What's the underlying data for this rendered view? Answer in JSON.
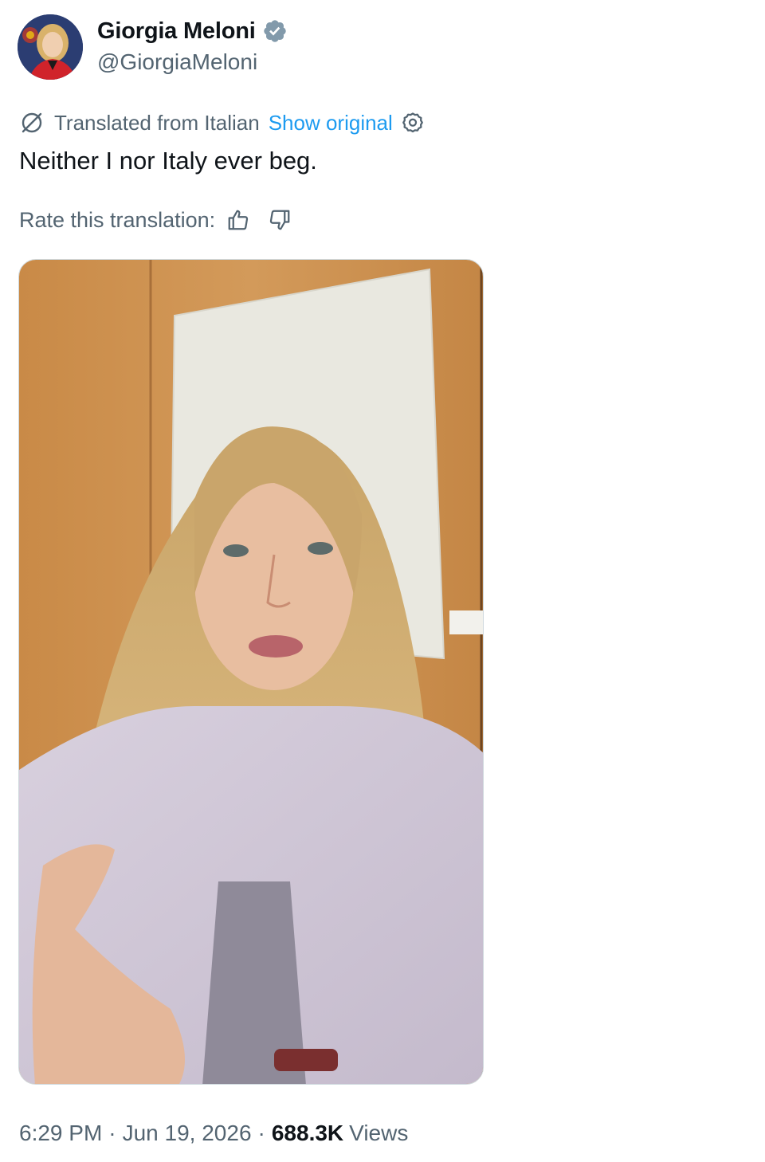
{
  "author": {
    "display_name": "Giorgia Meloni",
    "handle": "@GiorgiaMeloni",
    "verified": true,
    "avatar_icon": "profile-photo"
  },
  "translation": {
    "label": "Translated from Italian",
    "show_original_label": "Show original",
    "text": "Neither I nor Italy ever beg.",
    "rate_label": "Rate this translation:"
  },
  "media": {
    "type": "video",
    "alt": ""
  },
  "meta": {
    "time": "6:29 PM",
    "separator": "·",
    "date": "Jun 19, 2026",
    "views_count": "688.3K",
    "views_label": "Views"
  },
  "colors": {
    "link": "#1d9bf0",
    "secondary_text": "#536471",
    "primary_text": "#0f1419",
    "verified_badge": "#829aab"
  }
}
